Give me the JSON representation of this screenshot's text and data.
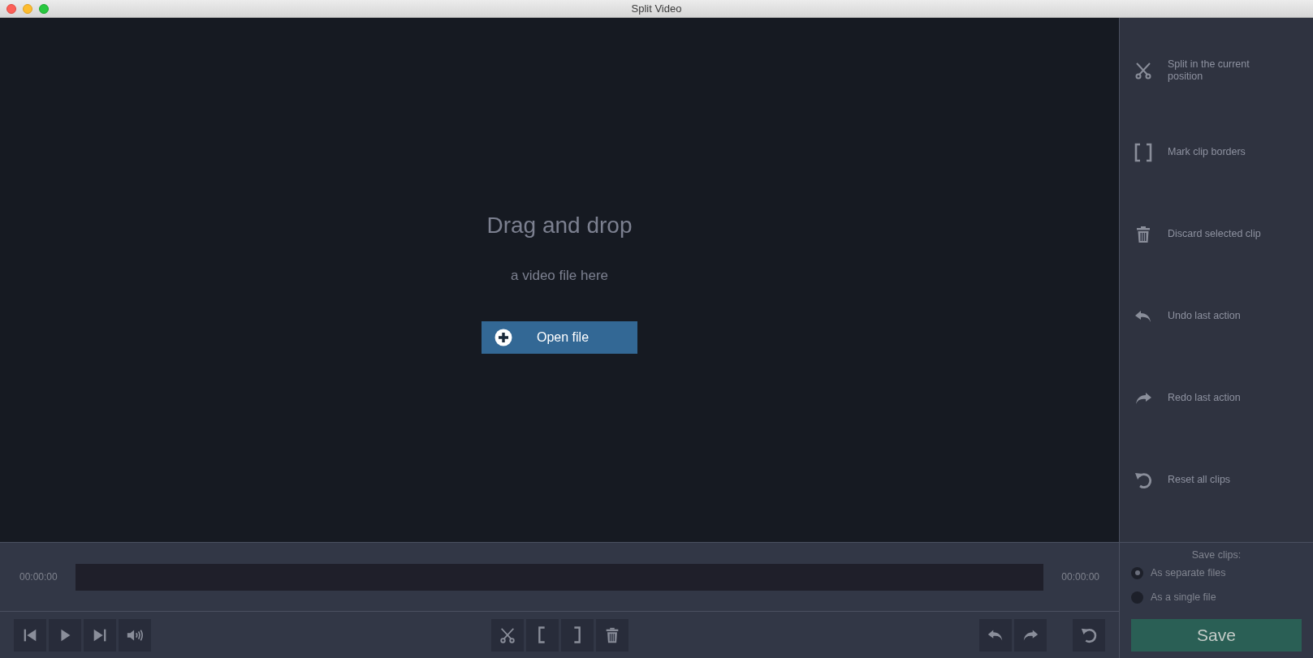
{
  "window": {
    "title": "Split Video"
  },
  "drop_zone": {
    "heading": "Drag and drop",
    "subtext": "a video file here",
    "button": "Open file"
  },
  "actions": [
    {
      "kind": "scissors",
      "label": "Split in the current position"
    },
    {
      "kind": "brackets",
      "label": "Mark clip borders"
    },
    {
      "kind": "trash",
      "label": "Discard selected clip"
    },
    {
      "kind": "undo",
      "label": "Undo last action"
    },
    {
      "kind": "redo",
      "label": "Redo last action"
    },
    {
      "kind": "reset",
      "label": "Reset all clips"
    }
  ],
  "timeline": {
    "start_time": "00:00:00",
    "end_time": "00:00:00"
  },
  "save": {
    "heading": "Save clips:",
    "options": [
      {
        "label": "As separate files",
        "selected": true
      },
      {
        "label": "As a single file",
        "selected": false
      }
    ],
    "button": "Save"
  },
  "toolbar": {
    "playback": [
      {
        "kind": "skip-back"
      },
      {
        "kind": "play"
      },
      {
        "kind": "skip-forward"
      },
      {
        "kind": "volume"
      }
    ],
    "editing": [
      {
        "kind": "scissors"
      },
      {
        "kind": "bracket-left"
      },
      {
        "kind": "bracket-right"
      },
      {
        "kind": "trash"
      }
    ],
    "history": [
      {
        "kind": "undo"
      },
      {
        "kind": "redo"
      }
    ],
    "reset": [
      {
        "kind": "reset"
      }
    ]
  }
}
